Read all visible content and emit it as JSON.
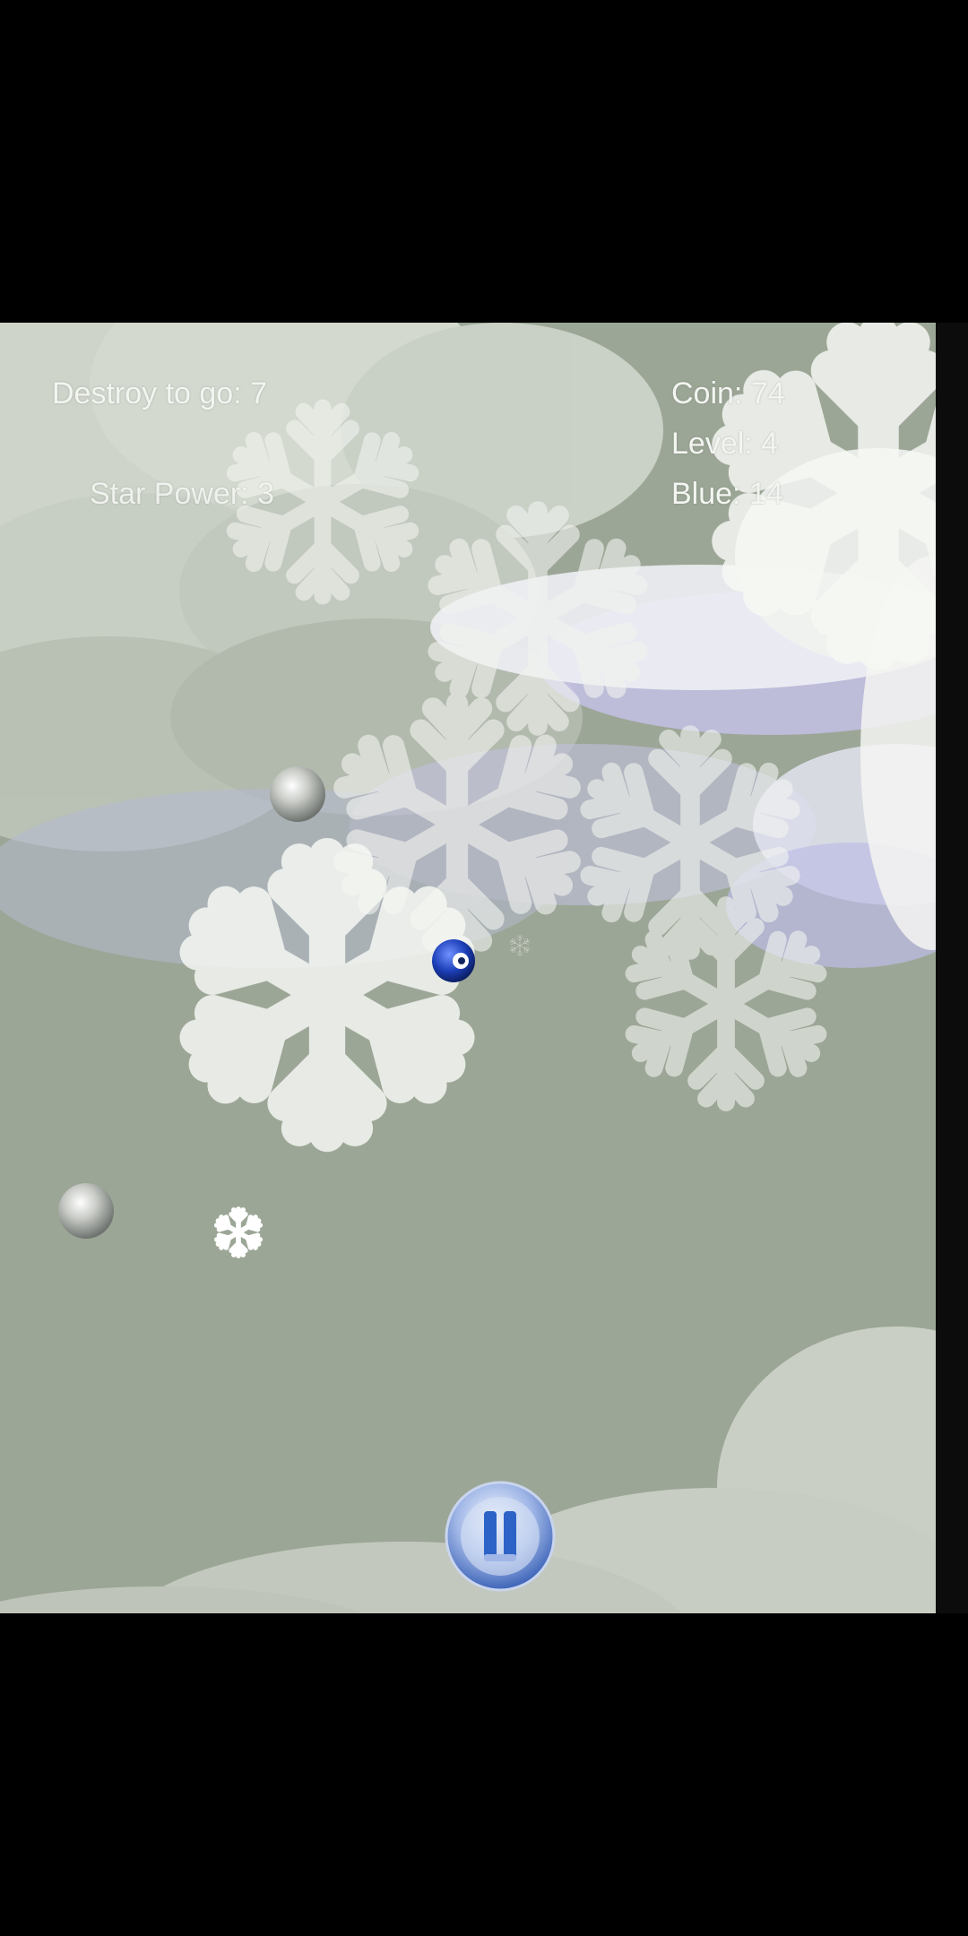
{
  "hud": {
    "destroy_to_go": "Destroy to go: 7",
    "star_power": "Star Power: 3",
    "coin": "Coin: 74",
    "level": "Level: 4",
    "blue": "Blue: 14"
  },
  "colors": {
    "background": "#9ca696",
    "cloud": "#d6dbd2",
    "cloud_shadow": "#b8b3e6",
    "snowflake": "#eef0ec",
    "player_ball": "#1d3fb8",
    "grey_ball": "#bfc2bd",
    "pause_button": "#2d63c7"
  },
  "icons": {
    "pause": "pause-icon",
    "snowflake": "snowflake-icon"
  }
}
